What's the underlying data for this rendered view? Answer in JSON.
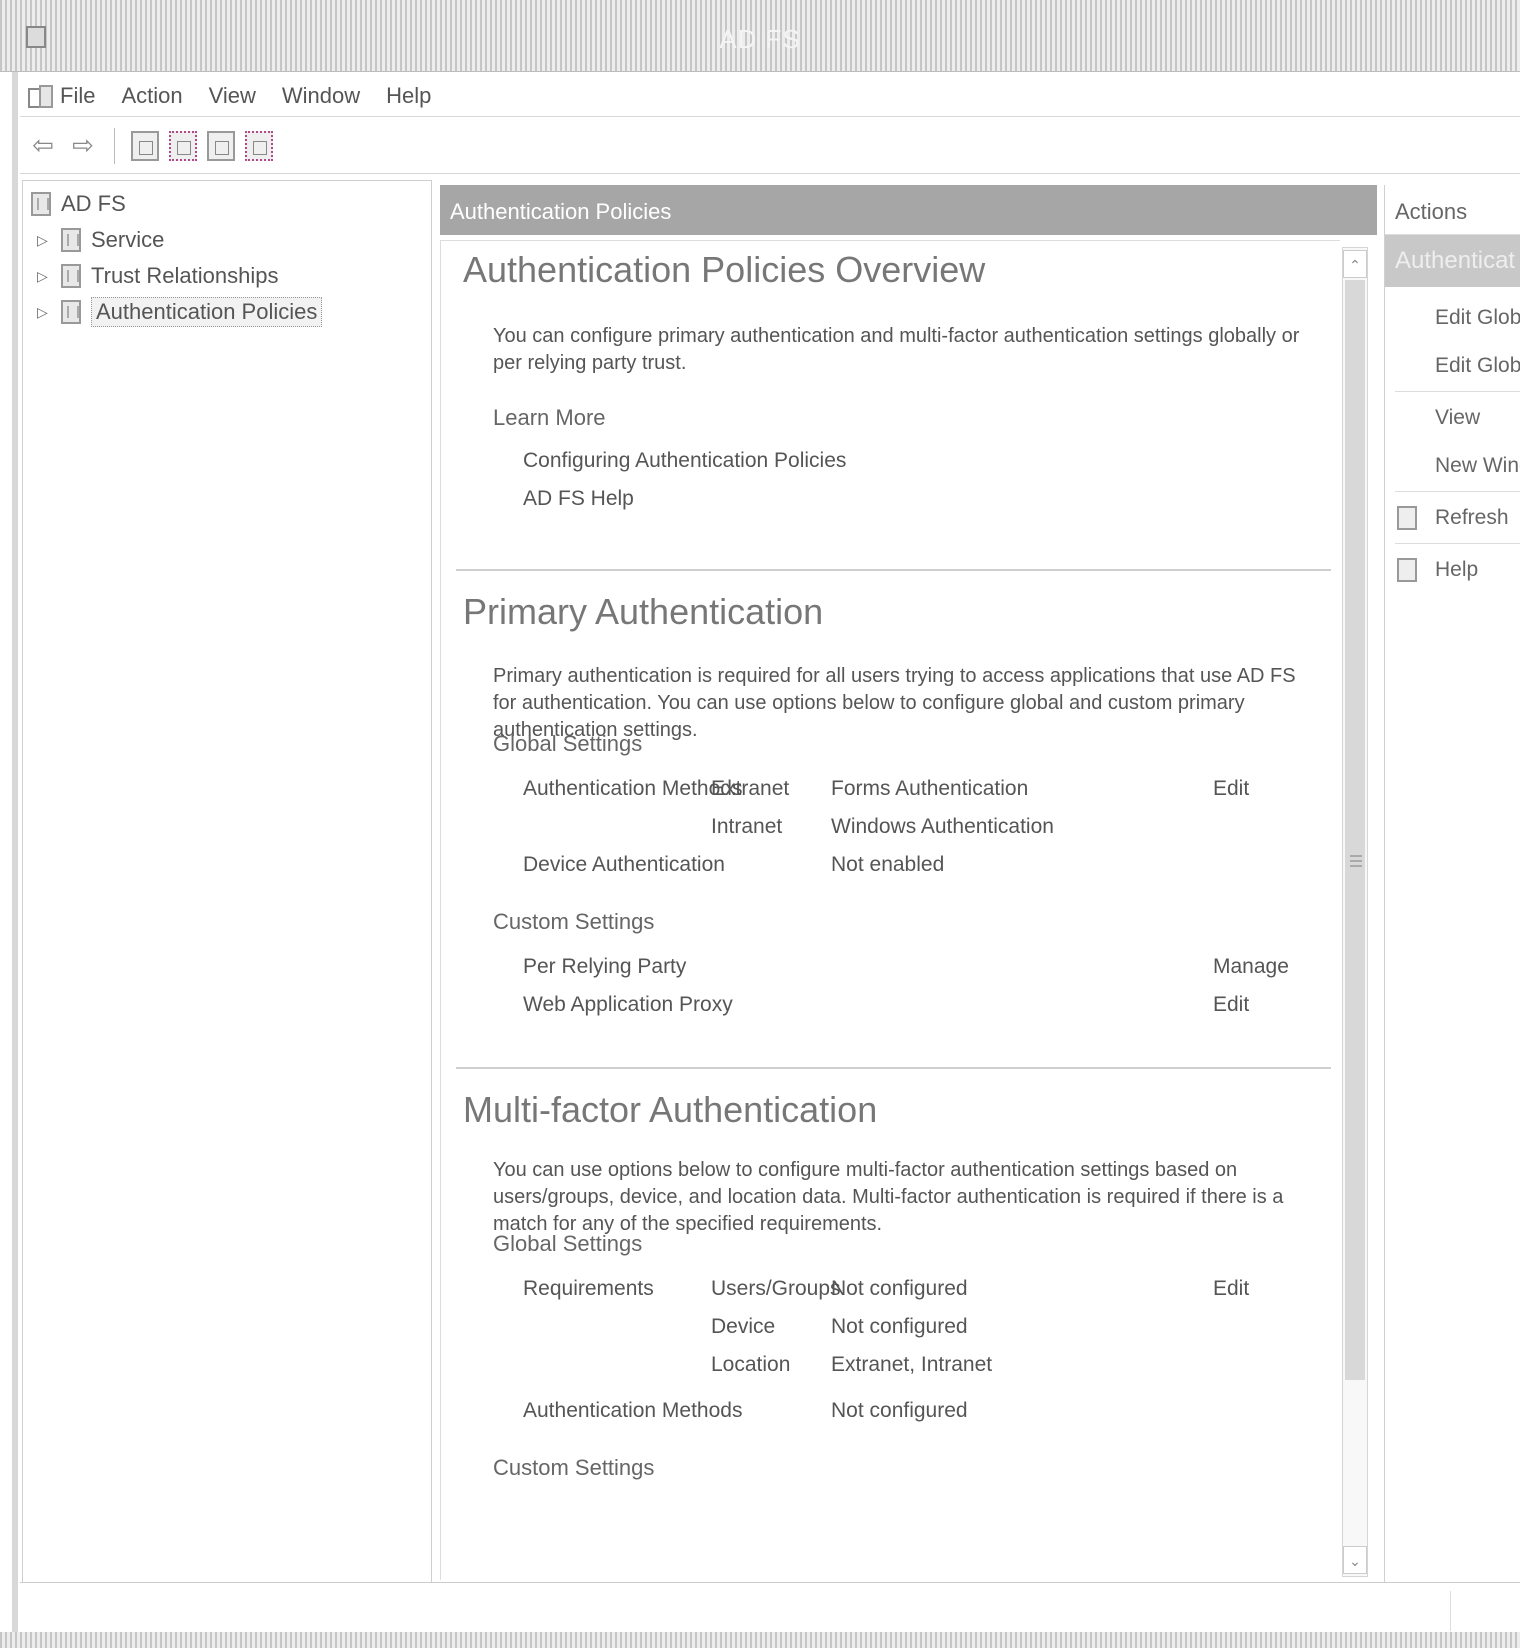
{
  "window": {
    "title": "AD FS"
  },
  "menu": [
    "File",
    "Action",
    "View",
    "Window",
    "Help"
  ],
  "tree": {
    "root": "AD FS",
    "items": [
      "Service",
      "Trust Relationships",
      "Authentication Policies"
    ]
  },
  "center": {
    "header": "Authentication Policies",
    "overview": {
      "title": "Authentication Policies Overview",
      "text": "You can configure primary authentication and multi-factor authentication settings globally or per relying party trust.",
      "learn_more": "Learn More",
      "links": [
        "Configuring Authentication Policies",
        "AD FS Help"
      ]
    },
    "primary": {
      "title": "Primary Authentication",
      "text": "Primary authentication is required for all users trying to access applications that use AD FS for authentication. You can use options below to configure global and custom primary authentication settings.",
      "global_settings": "Global Settings",
      "auth_methods_label": "Authentication Methods",
      "extranet_label": "Extranet",
      "extranet_value": "Forms Authentication",
      "intranet_label": "Intranet",
      "intranet_value": "Windows Authentication",
      "device_auth_label": "Device Authentication",
      "device_auth_value": "Not enabled",
      "edit_label": "Edit",
      "custom_settings": "Custom Settings",
      "per_relying_party": "Per Relying Party",
      "manage_label": "Manage",
      "web_app_proxy": "Web Application Proxy",
      "edit_label_2": "Edit"
    },
    "mfa": {
      "title": "Multi-factor Authentication",
      "text": "You can use options below to configure multi-factor authentication settings based on users/groups, device, and location data. Multi-factor authentication is required if there is a match for any of the specified requirements.",
      "global_settings": "Global Settings",
      "requirements_label": "Requirements",
      "users_groups_label": "Users/Groups",
      "users_groups_value": "Not configured",
      "device_label": "Device",
      "device_value": "Not configured",
      "location_label": "Location",
      "location_value": "Extranet, Intranet",
      "auth_methods_label": "Authentication Methods",
      "auth_methods_value": "Not configured",
      "edit_label": "Edit",
      "custom_settings": "Custom Settings"
    }
  },
  "actions": {
    "header": "Actions",
    "section": "Authenticat",
    "items": [
      "Edit Globa",
      "Edit Globa",
      "View",
      "New Wind",
      "Refresh",
      "Help"
    ]
  }
}
